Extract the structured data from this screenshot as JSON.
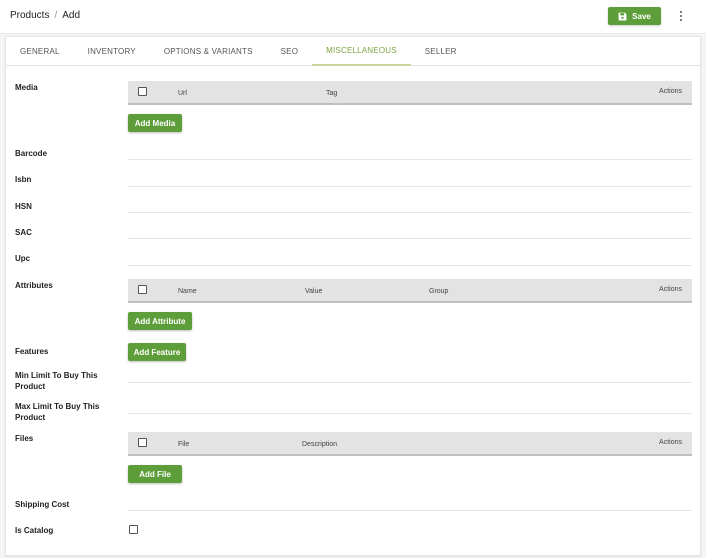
{
  "breadcrumb": {
    "parent": "Products",
    "separator": "/",
    "current": "Add"
  },
  "header": {
    "save_label": "Save"
  },
  "tabs": [
    {
      "label": "GENERAL"
    },
    {
      "label": "INVENTORY"
    },
    {
      "label": "OPTIONS & VARIANTS"
    },
    {
      "label": "SEO"
    },
    {
      "label": "MISCELLANEOUS"
    },
    {
      "label": "SELLER"
    }
  ],
  "active_tab": "MISCELLANEOUS",
  "media": {
    "label": "Media",
    "columns": [
      "Url",
      "Tag"
    ],
    "actions_label": "Actions",
    "add_button": "Add Media"
  },
  "fields": {
    "barcode": "Barcode",
    "isbn": "Isbn",
    "hsn": "HSN",
    "sac": "SAC",
    "upc": "Upc"
  },
  "attributes": {
    "label": "Attributes",
    "columns": [
      "Name",
      "Value",
      "Group"
    ],
    "actions_label": "Actions",
    "add_button": "Add Attribute"
  },
  "features": {
    "label": "Features",
    "add_button": "Add Feature"
  },
  "min_limit": {
    "label_line1": "Min Limit To Buy This",
    "label_line2": "Product"
  },
  "max_limit": {
    "label_line1": "Max Limit To Buy This",
    "label_line2": "Product"
  },
  "files": {
    "label": "Files",
    "columns": [
      "File",
      "Description"
    ],
    "actions_label": "Actions",
    "add_button": "Add File"
  },
  "shipping_cost": {
    "label": "Shipping Cost"
  },
  "is_catalog": {
    "label": "Is Catalog"
  },
  "colors": {
    "accent_green": "#5e9e3a",
    "active_tab": "#7aa441"
  }
}
